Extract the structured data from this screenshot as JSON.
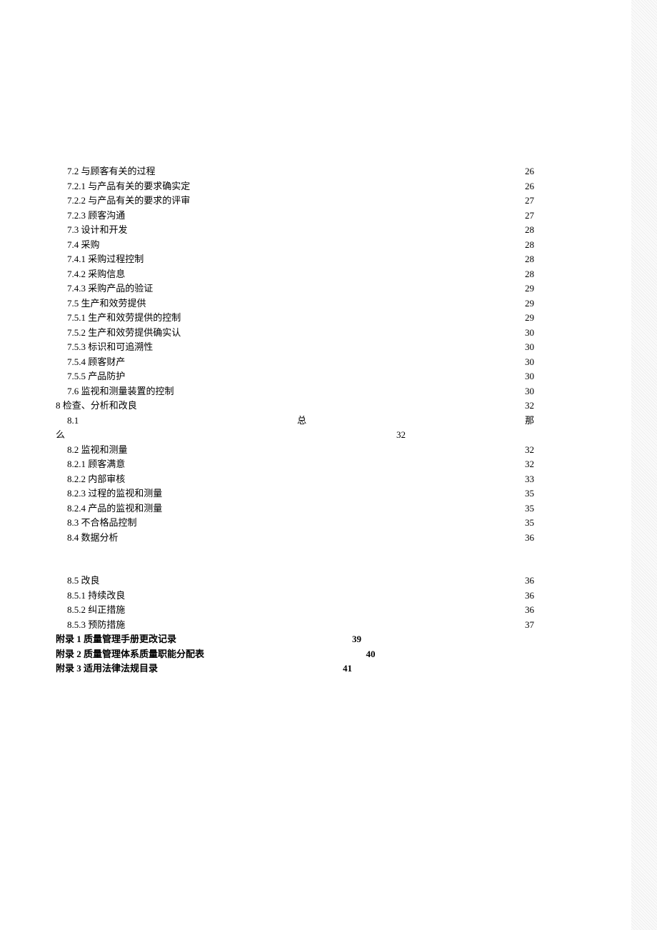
{
  "toc": [
    {
      "indent": 1,
      "label": "7.2   与顾客有关的过程",
      "page": "26"
    },
    {
      "indent": 1,
      "label": "7.2.1 与产品有关的要求确实定",
      "page": "26"
    },
    {
      "indent": 1,
      "label": "7.2.2 与产品有关的要求的评审",
      "page": "27"
    },
    {
      "indent": 1,
      "label": "7.2.3 顾客沟通",
      "page": "27"
    },
    {
      "indent": 1,
      "label": "7.3 设计和开发",
      "page": "28"
    },
    {
      "indent": 1,
      "label": "7.4 采购",
      "page": "28"
    },
    {
      "indent": 1,
      "label": "7.4.1 采购过程控制",
      "page": "28"
    },
    {
      "indent": 1,
      "label": "7.4.2 采购信息",
      "page": "28"
    },
    {
      "indent": 1,
      "label": "7.4.3 采购产品的验证",
      "page": "29"
    },
    {
      "indent": 1,
      "label": "7.5   生产和效劳提供",
      "page": "29"
    },
    {
      "indent": 1,
      "label": "7.5.1 生产和效劳提供的控制",
      "page": "29"
    },
    {
      "indent": 1,
      "label": "7.5.2 生产和效劳提供确实认",
      "page": "30"
    },
    {
      "indent": 1,
      "label": "7.5.3 标识和可追溯性",
      "page": "30"
    },
    {
      "indent": 1,
      "label": "7.5.4 顾客财产",
      "page": "30"
    },
    {
      "indent": 1,
      "label": "7.5.5 产品防护",
      "page": "30"
    },
    {
      "indent": 1,
      "label": "7.6 监视和测量装置的控制",
      "page": "30"
    },
    {
      "indent": 0,
      "label": "8   检查、分析和改良",
      "page": "32"
    }
  ],
  "toc81": {
    "left": "8.1",
    "mid": "总",
    "right": "那",
    "contLeft": "么",
    "contPage": "32"
  },
  "toc2": [
    {
      "indent": 1,
      "label": "8.2   监视和测量",
      "page": "32"
    },
    {
      "indent": 1,
      "label": "8.2.1 顾客满意",
      "page": "32"
    },
    {
      "indent": 1,
      "label": "8.2.2 内部审核",
      "page": "33"
    },
    {
      "indent": 1,
      "label": "8.2.3 过程的监视和测量",
      "page": "35"
    },
    {
      "indent": 1,
      "label": "8.2.4 产品的监视和测量",
      "page": "35"
    },
    {
      "indent": 1,
      "label": "8.3   不合格品控制",
      "page": "35"
    },
    {
      "indent": 1,
      "label": "8.4   数据分析",
      "page": "36"
    }
  ],
  "toc3": [
    {
      "indent": 1,
      "label": "8.5   改良",
      "page": "36"
    },
    {
      "indent": 1,
      "label": "8.5.1 持续改良",
      "page": "36"
    },
    {
      "indent": 1,
      "label": "8.5.2   纠正措施",
      "page": "36"
    },
    {
      "indent": 1,
      "label": "8.5.3   预防措施",
      "page": "37"
    }
  ],
  "appendix": [
    {
      "label": "附录 1  质量管理手册更改记录",
      "page": "39",
      "partialDots": true
    },
    {
      "label": "附录 2  质量管理体系质量职能分配表",
      "page": "40",
      "partialDots": true
    },
    {
      "label": "附录 3  适用法律法规目录",
      "page": "41",
      "partialDots": true
    }
  ]
}
